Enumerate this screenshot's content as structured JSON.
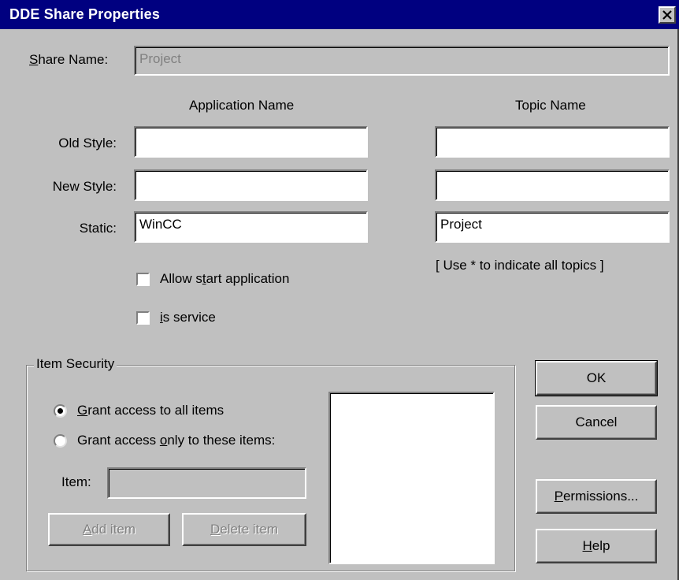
{
  "window": {
    "title": "DDE Share Properties",
    "close_icon": "close-icon"
  },
  "share_name": {
    "label_u": "S",
    "label_rest": "hare Name:",
    "value": "Project"
  },
  "columns": {
    "application": "Application Name",
    "topic": "Topic Name"
  },
  "rows": {
    "old_style": {
      "label": "Old Style:",
      "app": "",
      "topic": ""
    },
    "new_style": {
      "label": "New Style:",
      "app": "",
      "topic": ""
    },
    "static": {
      "label": "Static:",
      "app": "WinCC",
      "topic": "Project"
    }
  },
  "topic_hint": "[ Use * to indicate all topics ]",
  "options": {
    "allow_start": {
      "pre": "Allow s",
      "u": "t",
      "post": "art application",
      "checked": false
    },
    "is_service": {
      "pre": "",
      "u": "i",
      "post": "s service",
      "checked": false
    }
  },
  "item_security": {
    "title": "Item Security",
    "grant_all": {
      "u": "G",
      "rest": "rant access to all items",
      "selected": true
    },
    "grant_only": {
      "pre": "Grant access ",
      "u": "o",
      "post": "nly to these items:",
      "selected": false
    },
    "item_label": "Item:",
    "item_value": "",
    "add_item": {
      "u": "A",
      "rest": "dd item"
    },
    "delete_item": {
      "u": "D",
      "rest": "elete item"
    }
  },
  "buttons": {
    "ok": "OK",
    "cancel": "Cancel",
    "permissions": {
      "u": "P",
      "rest": "ermissions..."
    },
    "help": {
      "u": "H",
      "rest": "elp"
    }
  }
}
